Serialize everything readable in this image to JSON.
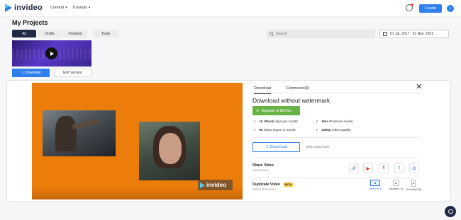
{
  "app": {
    "brand": "invideo",
    "accent": "#2f80ed",
    "dark": "#1f2a44"
  },
  "nav": {
    "content": "Content",
    "tutorials": "Tutorials"
  },
  "header": {
    "create": "Create",
    "avatar_initial": "L",
    "notification_icon": "bell-icon"
  },
  "page": {
    "title": "My Projects"
  },
  "filter_tabs": [
    {
      "label": "All",
      "active": true
    },
    {
      "label": "Drafts",
      "active": false
    },
    {
      "label": "Finished",
      "active": false
    },
    {
      "label": "Trash",
      "active": false
    }
  ],
  "search": {
    "placeholder": "Search"
  },
  "date_range": "01 Jul, 2017 - 01 Nov, 2021",
  "project_card": {
    "download": "Download",
    "edit": "Edit Version"
  },
  "panel": {
    "tabs": [
      {
        "label": "Download",
        "active": true
      },
      {
        "label": "Comments(0)",
        "active": false
      }
    ],
    "title": "Download without watermark",
    "upgrade": "Upgrade at $15/mo",
    "features": [
      {
        "bold": "10 iStock",
        "rest": "clips per month"
      },
      {
        "bold": "1M+",
        "rest": "Premium media"
      },
      {
        "bold": "60",
        "rest": "video export a month"
      },
      {
        "bold": "1080p",
        "rest": "video quality"
      }
    ],
    "download_button": "Download",
    "with_watermark": "With watermark",
    "share_title": "Share Video",
    "share_sub": "Get reviews",
    "share_icons": [
      "link-icon",
      "youtube-icon",
      "facebook-icon",
      "twitter-icon",
      "team-icon"
    ],
    "duplicate_title": "Duplicate Video",
    "duplicate_sub": "Select dimension",
    "beta": "BETA",
    "dimensions": [
      {
        "label": "Wide(16:9)",
        "selected": true
      },
      {
        "label": "Square(1:1)",
        "selected": false
      },
      {
        "label": "Vertical(9:16)",
        "selected": false
      }
    ]
  },
  "video": {
    "watermark": "invideo",
    "background": "#ed7d0a"
  }
}
